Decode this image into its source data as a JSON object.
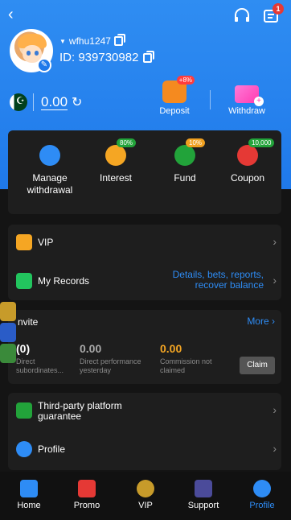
{
  "header": {
    "back_icon": "chevron-left-icon",
    "support_icon": "headset-icon",
    "message_icon": "message-icon",
    "message_badge": "1"
  },
  "profile": {
    "username": "wfhu1247",
    "id_label": "ID: 939730982",
    "balance": "0.00"
  },
  "actions": {
    "deposit": {
      "label": "Deposit",
      "badge": "+8%"
    },
    "withdraw": {
      "label": "Withdraw"
    }
  },
  "finance": [
    {
      "label": "Manage\nwithdrawal",
      "badge": "",
      "color": "#2e8cf5"
    },
    {
      "label": "Interest",
      "badge": "80%",
      "color": "#f5a623"
    },
    {
      "label": "Fund",
      "badge": "10%",
      "color": "#22a33a"
    },
    {
      "label": "Coupon",
      "badge": "10,000",
      "color": "#e53935"
    }
  ],
  "menu1": {
    "vip": {
      "label": "VIP"
    },
    "records": {
      "label": "My Records",
      "desc": "Details, bets, reports, recover balance"
    }
  },
  "invite": {
    "title": "nvite",
    "more": "More",
    "stats": [
      {
        "value": "(0)",
        "label": "Direct subordinates..."
      },
      {
        "value": "0.00",
        "label": "Direct performance yesterday"
      },
      {
        "value": "0.00",
        "label": "Commission not claimed"
      }
    ],
    "claim": "Claim"
  },
  "menu2": {
    "third_party": "Third-party platform guarantee",
    "profile": "Profile"
  },
  "tabs": [
    {
      "label": "Home"
    },
    {
      "label": "Promo"
    },
    {
      "label": "VIP"
    },
    {
      "label": "Support"
    },
    {
      "label": "Profile"
    }
  ],
  "colors": {
    "primary": "#2e8cf5",
    "bg": "#141414",
    "panel": "#1e1e1e"
  }
}
